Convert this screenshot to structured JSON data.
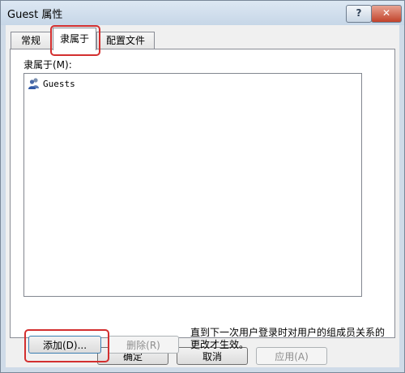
{
  "window": {
    "title": "Guest 属性",
    "help_label": "?",
    "close_label": "✕"
  },
  "tabs": [
    {
      "label": "常规",
      "active": false
    },
    {
      "label": "隶属于",
      "active": true
    },
    {
      "label": "配置文件",
      "active": false
    }
  ],
  "panel": {
    "member_label": "隶属于(M):",
    "members": [
      {
        "label": "Guests",
        "icon": "group-icon"
      }
    ],
    "add_label": "添加(D)...",
    "remove_label": "删除(R)",
    "hint": "直到下一次用户登录时对用户的组成员关系的更改才生效。"
  },
  "footer": {
    "ok_label": "确定",
    "cancel_label": "取消",
    "apply_label": "应用(A)"
  },
  "colors": {
    "highlight": "#d32f2f",
    "close_button": "#c2432b"
  }
}
